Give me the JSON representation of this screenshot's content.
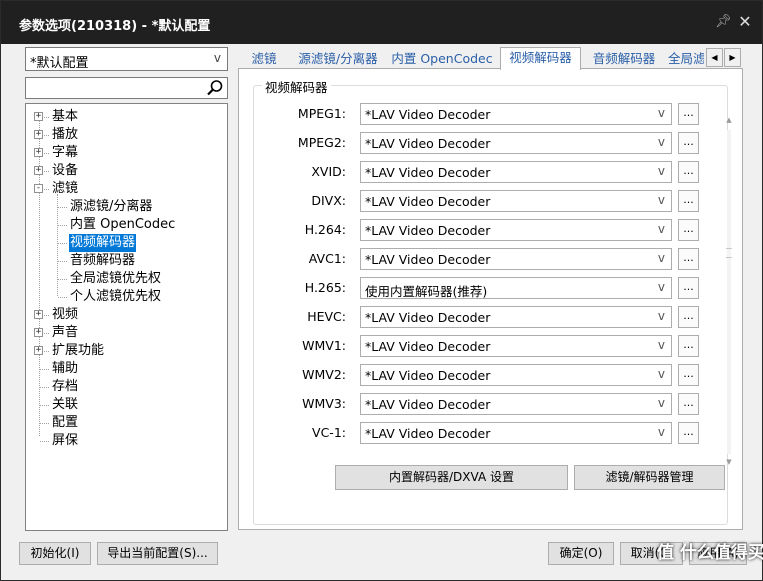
{
  "window": {
    "title": "参数选项(210318) - *默认配置"
  },
  "sidebar": {
    "profile_value": "*默认配置",
    "search_placeholder": "",
    "tree": [
      {
        "label": "基本",
        "expander": "+"
      },
      {
        "label": "播放",
        "expander": "+"
      },
      {
        "label": "字幕",
        "expander": "+"
      },
      {
        "label": "设备",
        "expander": "+"
      },
      {
        "label": "滤镜",
        "expander": "-"
      },
      {
        "label": "源滤镜/分离器"
      },
      {
        "label": "内置 OpenCodec"
      },
      {
        "label": "视频解码器",
        "selected": true
      },
      {
        "label": "音频解码器"
      },
      {
        "label": "全局滤镜优先权"
      },
      {
        "label": "个人滤镜优先权"
      },
      {
        "label": "视频",
        "expander": "+"
      },
      {
        "label": "声音",
        "expander": "+"
      },
      {
        "label": "扩展功能",
        "expander": "+"
      },
      {
        "label": "辅助"
      },
      {
        "label": "存档"
      },
      {
        "label": "关联"
      },
      {
        "label": "配置"
      },
      {
        "label": "屏保"
      }
    ]
  },
  "tabs": [
    {
      "label": "滤镜"
    },
    {
      "label": "源滤镜/分离器"
    },
    {
      "label": "内置 OpenCodec"
    },
    {
      "label": "视频解码器",
      "active": true
    },
    {
      "label": "音频解码器"
    },
    {
      "label": "全局滤"
    }
  ],
  "group": {
    "title": "视频解码器",
    "rows": [
      {
        "label": "MPEG1:",
        "value": "*LAV Video Decoder"
      },
      {
        "label": "MPEG2:",
        "value": "*LAV Video Decoder"
      },
      {
        "label": "XVID:",
        "value": "*LAV Video Decoder"
      },
      {
        "label": "DIVX:",
        "value": "*LAV Video Decoder"
      },
      {
        "label": "H.264:",
        "value": "*LAV Video Decoder"
      },
      {
        "label": "AVC1:",
        "value": "*LAV Video Decoder"
      },
      {
        "label": "H.265:",
        "value": "使用内置解码器(推荐)"
      },
      {
        "label": "HEVC:",
        "value": "*LAV Video Decoder"
      },
      {
        "label": "WMV1:",
        "value": "*LAV Video Decoder"
      },
      {
        "label": "WMV2:",
        "value": "*LAV Video Decoder"
      },
      {
        "label": "WMV3:",
        "value": "*LAV Video Decoder"
      },
      {
        "label": "VC-1:",
        "value": "*LAV Video Decoder"
      }
    ],
    "more_label": "...",
    "btn_builtin": "内置解码器/DXVA 设置",
    "btn_manage": "滤镜/解码器管理"
  },
  "footer": {
    "init_btn": "初始化(I)",
    "export_btn": "导出当前配置(S)...",
    "ok_btn": "确定(O)",
    "cancel_btn": "取消(C)",
    "apply_btn": "应用(A)"
  },
  "watermark": "值 什么值得买"
}
